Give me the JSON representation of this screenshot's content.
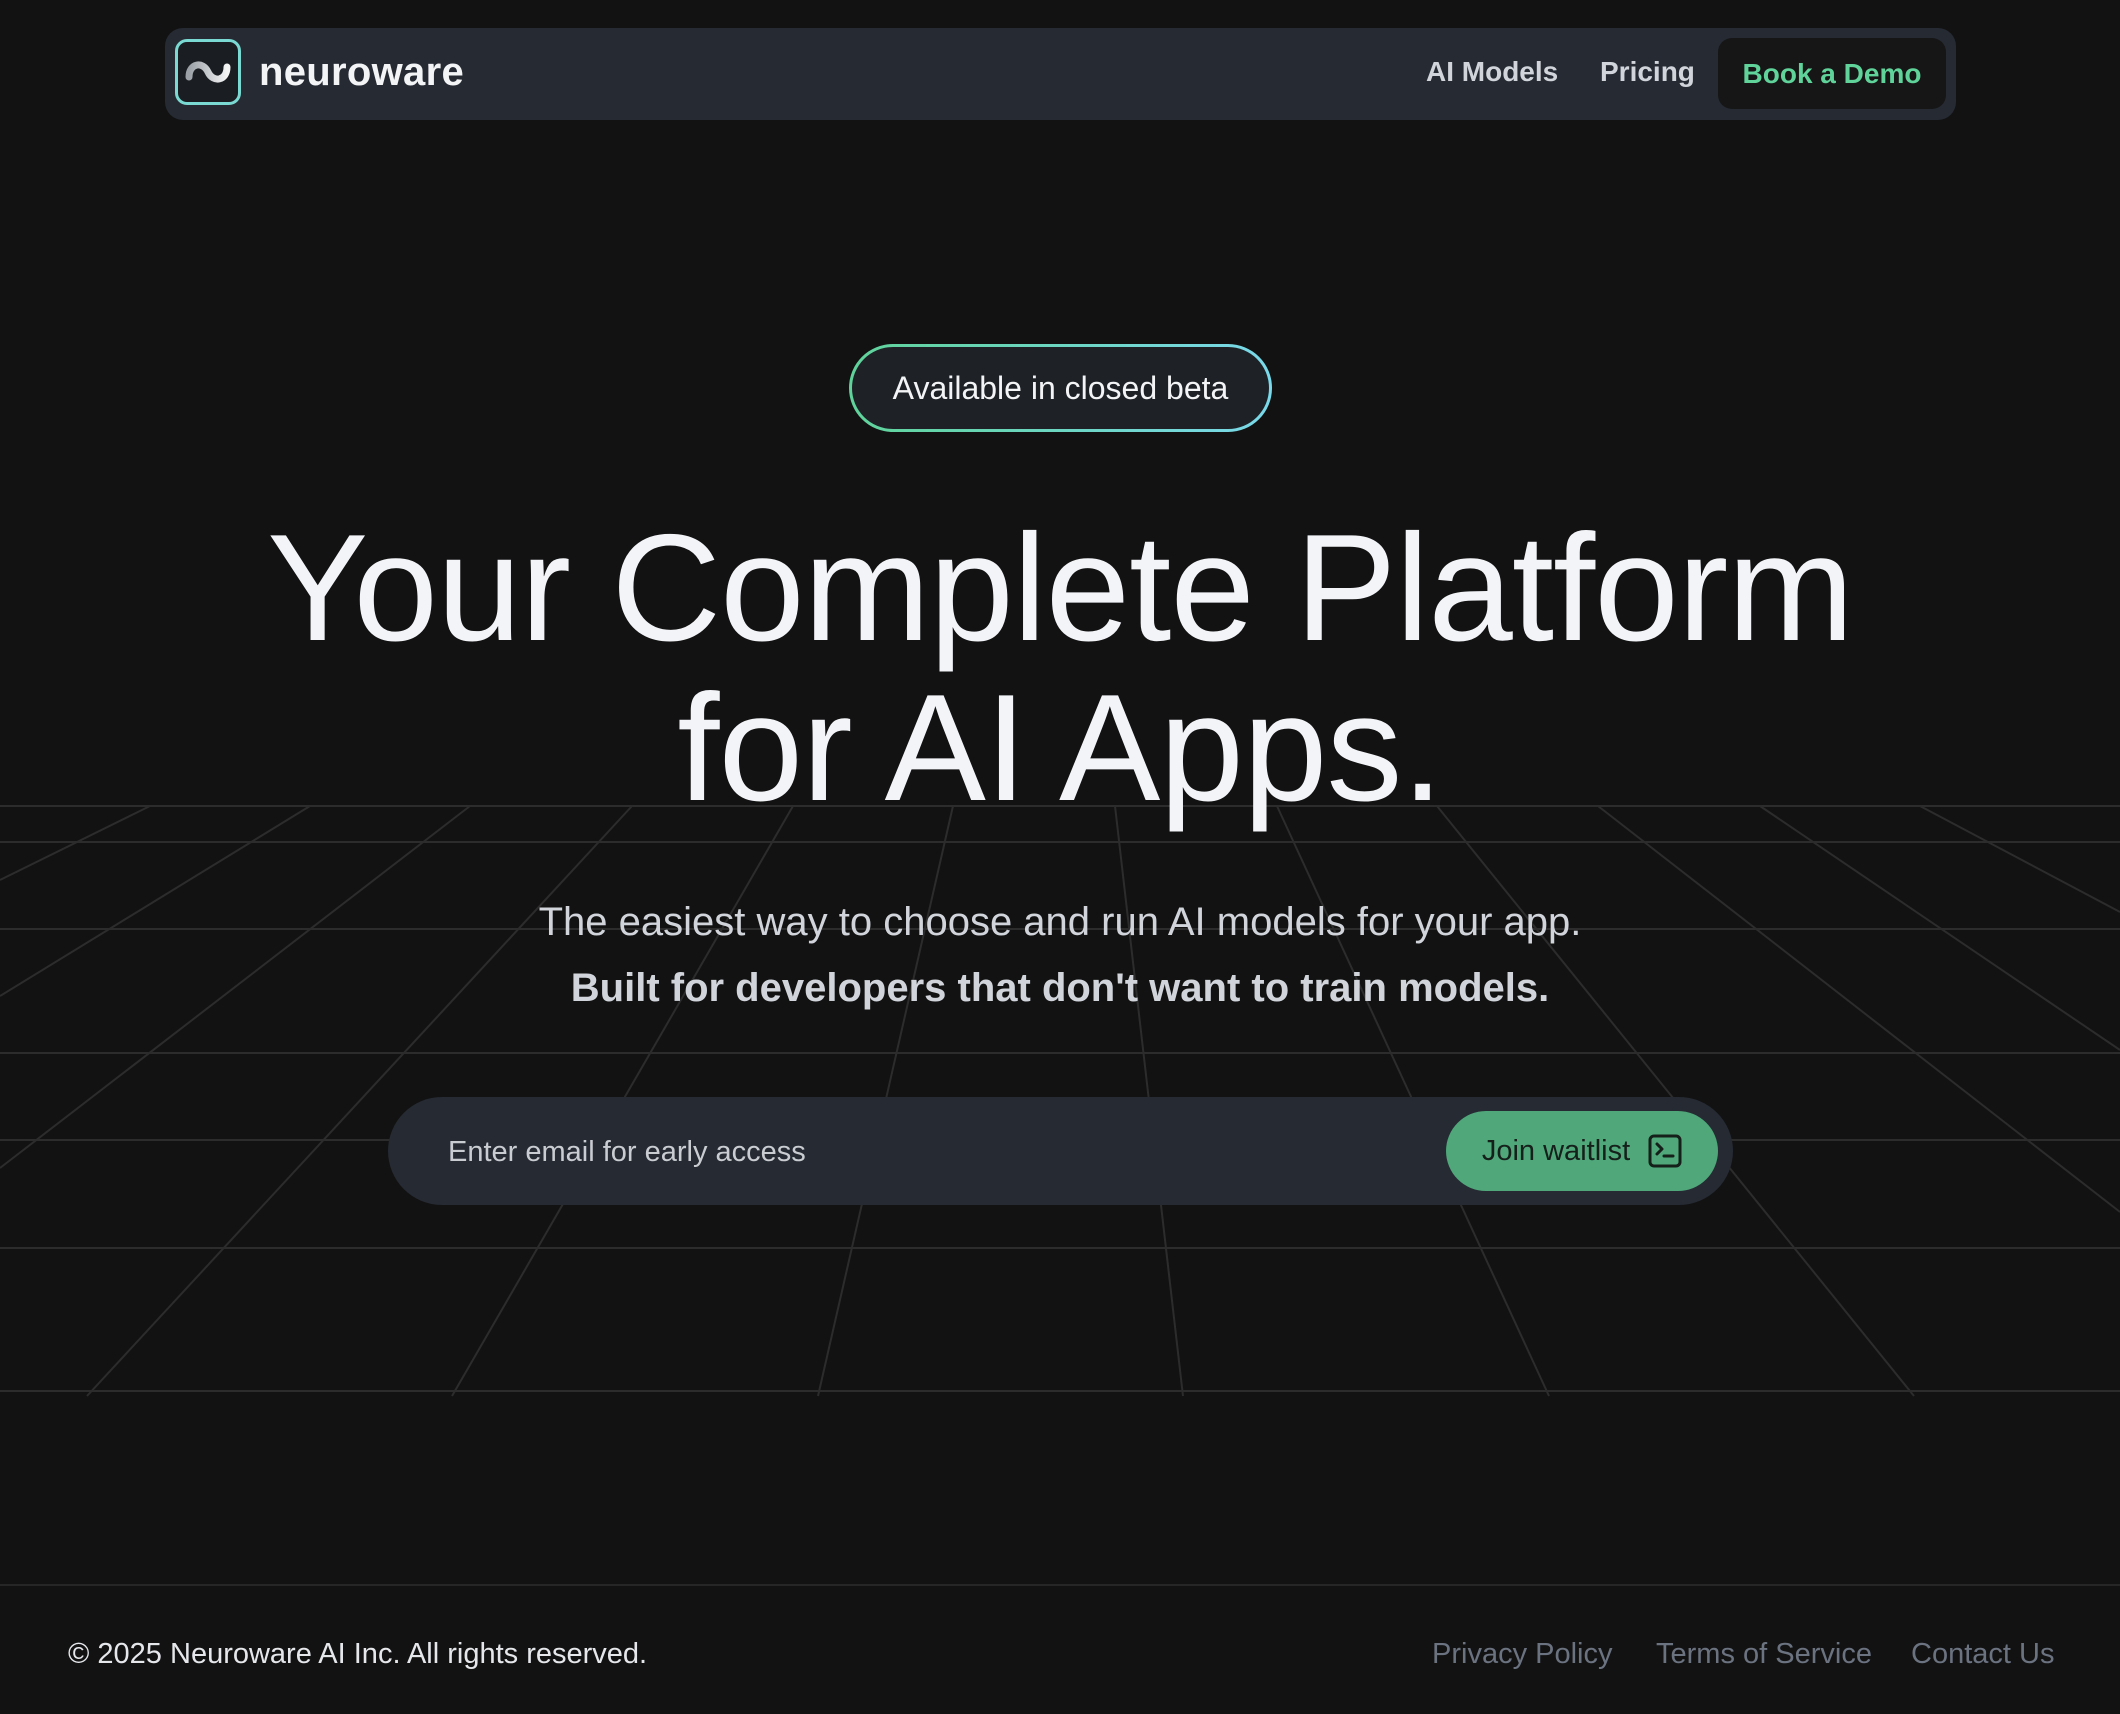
{
  "nav": {
    "brand": "neuroware",
    "links": [
      "AI Models",
      "Pricing"
    ],
    "cta_label": "Book a Demo"
  },
  "hero": {
    "badge": "Available in closed beta",
    "headline_line1": "Your Complete Platform",
    "headline_line2": "for AI Apps.",
    "subtitle": "The easiest way to choose and run AI models for your app.",
    "subtitle_bold": "Built for developers that don't want to train models."
  },
  "signup": {
    "email_placeholder": "Enter email for early access",
    "email_value": "",
    "button_label": "Join waitlist"
  },
  "footer": {
    "copyright": "© 2025 Neuroware AI Inc. All rights reserved.",
    "links": [
      "Privacy Policy",
      "Terms of Service",
      "Contact Us"
    ]
  },
  "colors": {
    "background": "#121212",
    "nav_bg": "#252a33",
    "accent_green": "#5fd39a",
    "button_green": "#4fa77a",
    "logo_border": "#7ad9d2"
  },
  "icons": {
    "logo": "infinity-wave-icon",
    "join_button": "terminal-icon"
  }
}
